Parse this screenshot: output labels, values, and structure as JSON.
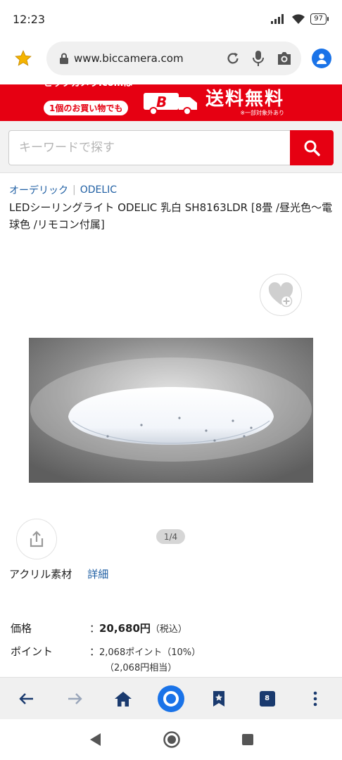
{
  "status_bar": {
    "time": "12:23",
    "battery": "97"
  },
  "browser": {
    "url": "www.biccamera.com"
  },
  "banner": {
    "logo": "ビックカメラ.comは",
    "pill": "1個のお買い物でも",
    "headline": "送料無料",
    "note": "※一部対象外あり"
  },
  "search": {
    "placeholder": "キーワードで探す"
  },
  "product": {
    "brand_jp": "オーデリック",
    "brand_en": "ODELIC",
    "title": "LEDシーリングライト ODELIC 乳白 SH8163LDR [8畳 /昼光色～電球色 /リモコン付属]",
    "image_counter": "1/4",
    "material": "アクリル素材",
    "detail_link": "詳細"
  },
  "pricing": {
    "price_label": "価格",
    "colon": "：",
    "price_value": "20,680円",
    "price_tax": "（税込）",
    "point_label": "ポイント",
    "point_value": "2,068ポイント",
    "point_rate": "（10%）",
    "point_equiv": "（2,068円相当）"
  },
  "browser_nav": {
    "tab_count": "8"
  },
  "colors": {
    "brand_red": "#e60012",
    "link_blue": "#1f5fa3",
    "chrome_blue": "#1a73e8"
  }
}
